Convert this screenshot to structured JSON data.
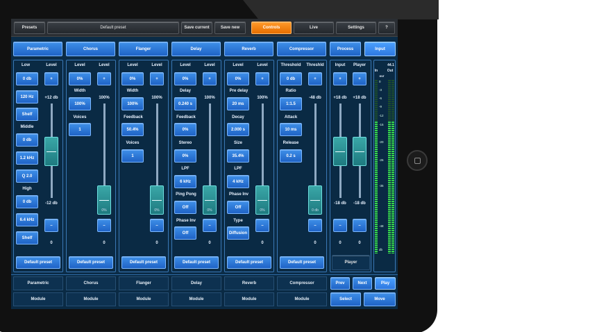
{
  "topbar": {
    "presets": "Presets",
    "preset_name": "Default preset",
    "save_current": "Save current",
    "save_new": "Save new",
    "controls": "Controls",
    "live": "Live",
    "settings": "Settings",
    "help": "?"
  },
  "modules": [
    "Parametric",
    "Chorus",
    "Flanger",
    "Delay",
    "Reverb",
    "Compressor",
    "Process",
    "Input"
  ],
  "parametric": {
    "low": "Low",
    "level": "Level",
    "low_gain": "0 db",
    "low_freq": "120 Hz",
    "low_type": "Shelf",
    "middle": "Middle",
    "mid_gain": "0 db",
    "mid_freq": "1.2 kHz",
    "mid_q": "Q 2.0",
    "high": "High",
    "high_gain": "0 db",
    "high_freq": "6.4 kHz",
    "high_type": "Shelf",
    "plus": "+",
    "minus": "–",
    "top_db": "+12 db",
    "bottom_db": "-12 db",
    "value": "0"
  },
  "chorus": {
    "level": "Level",
    "level2": "Level",
    "pct": "0%",
    "plus": "+",
    "width": "Width",
    "width_val": "100%",
    "voices": "Voices",
    "voices_val": "1",
    "top": "100%",
    "knob": "0%",
    "minus": "–",
    "value": "0"
  },
  "flanger": {
    "level": "Level",
    "level2": "Level",
    "pct": "0%",
    "plus": "+",
    "width": "Width",
    "width_val": "100%",
    "feedback": "Feedback",
    "feedback_val": "50.4%",
    "voices": "Voices",
    "voices_val": "1",
    "top": "100%",
    "knob": "0%",
    "minus": "–",
    "value": "0"
  },
  "delay": {
    "level": "Level",
    "level2": "Level",
    "pct": "0%",
    "plus": "+",
    "delay": "Delay",
    "delay_val": "0.240 s",
    "feedback": "Feedback",
    "feedback_val": "0%",
    "stereo": "Stereo",
    "stereo_val": "0%",
    "lpf": "LPF",
    "lpf_val": "6 kHz",
    "ping": "Ping Pong",
    "ping_val": "Off",
    "phase": "Phase Inv",
    "phase_val": "Off",
    "top": "100%",
    "knob": "0%",
    "minus": "–",
    "value": "0"
  },
  "reverb": {
    "level": "Level",
    "level2": "Level",
    "pct": "0%",
    "plus": "+",
    "predelay": "Pre delay",
    "predelay_val": "20 ms",
    "decay": "Decay",
    "decay_val": "2.000 s",
    "size": "Size",
    "size_val": "35.4%",
    "lpf": "LPF",
    "lpf_val": "4 kHz",
    "phase": "Phase Inv",
    "phase_val": "Off",
    "type": "Type",
    "type_val": "Diffusion",
    "top": "100%",
    "knob": "0%",
    "minus": "–",
    "value": "0"
  },
  "compressor": {
    "threshold": "Threshold",
    "threshold2": "Threshld",
    "thr_val": "0 db",
    "plus": "+",
    "ratio": "Ratio",
    "ratio_val": "1:1.5",
    "attack": "Attack",
    "attack_val": "10 ms",
    "release": "Release",
    "release_val": "0.2 s",
    "top": "-48 db",
    "knob": "0 db",
    "minus": "–",
    "value": "0"
  },
  "process": {
    "input": "Input",
    "player": "Player",
    "plus1": "+",
    "plus2": "+",
    "top1": "+18 db",
    "top2": "+18 db",
    "bottom1": "-18 db",
    "bottom2": "-18 db",
    "minus1": "–",
    "minus2": "–",
    "value1": "0",
    "value2": "0",
    "player_btn": "Player"
  },
  "meter": {
    "in": "In",
    "out": "Out",
    "rate": "44.1",
    "ovr": "ovr",
    "scale": [
      "0",
      "-3",
      "-6",
      "-9",
      "-12",
      "-15",
      "-20",
      "-26",
      "-35",
      "-48",
      "db"
    ]
  },
  "default_preset": "Default preset",
  "bottom": {
    "names": [
      "Parametric",
      "Chorus",
      "Flanger",
      "Delay",
      "Reverb",
      "Compressor"
    ],
    "module": "Module",
    "prev": "Prev",
    "next": "Next",
    "play": "Play",
    "select": "Select",
    "move": "Move"
  }
}
